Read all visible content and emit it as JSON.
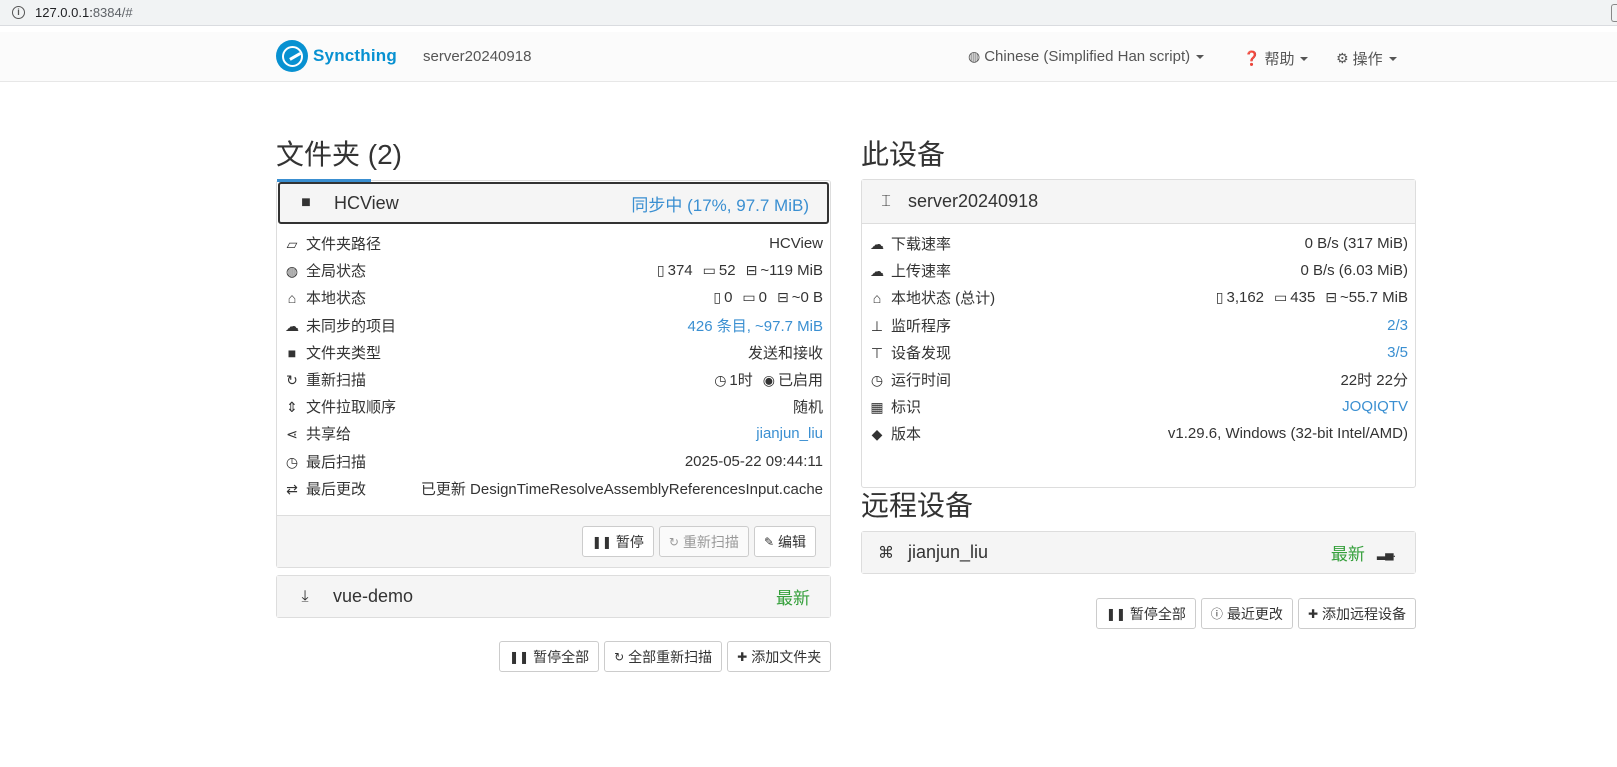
{
  "browser": {
    "url_host": "127.0.0.1:",
    "url_rest": "8384/#"
  },
  "navbar": {
    "brand": "Syncthing",
    "device_name": "server20240918",
    "language": "Chinese (Simplified Han script)",
    "help": "帮助",
    "actions": "操作"
  },
  "folders": {
    "title": "文件夹 (2)",
    "progress_percent": 17,
    "hcview": {
      "name": "HCView",
      "status": "同步中 (17%, 97.7 MiB)",
      "rows": {
        "path": {
          "label": "文件夹路径",
          "value": "HCView"
        },
        "global": {
          "label": "全局状态",
          "files": "374",
          "dirs": "52",
          "size": "~119 MiB"
        },
        "local": {
          "label": "本地状态",
          "files": "0",
          "dirs": "0",
          "size": "~0 B"
        },
        "out_of_sync": {
          "label": "未同步的项目",
          "value": "426 条目, ~97.7 MiB"
        },
        "type": {
          "label": "文件夹类型",
          "value": "发送和接收"
        },
        "rescan": {
          "label": "重新扫描",
          "interval": "1时",
          "watcher": "已启用"
        },
        "pull_order": {
          "label": "文件拉取顺序",
          "value": "随机"
        },
        "shared_with": {
          "label": "共享给",
          "value": "jianjun_liu"
        },
        "last_scan": {
          "label": "最后扫描",
          "value": "2025-05-22 09:44:11"
        },
        "last_change": {
          "label": "最后更改",
          "value": "已更新 DesignTimeResolveAssemblyReferencesInput.cache"
        }
      },
      "buttons": {
        "pause": "暂停",
        "rescan": "重新扫描",
        "edit": "编辑"
      }
    },
    "vue_demo": {
      "name": "vue-demo",
      "status": "最新"
    },
    "buttons": {
      "pause_all": "暂停全部",
      "rescan_all": "全部重新扫描",
      "add_folder": "添加文件夹"
    }
  },
  "this_device": {
    "title": "此设备",
    "name": "server20240918",
    "rows": {
      "download": {
        "label": "下载速率",
        "value": "0 B/s (317 MiB)"
      },
      "upload": {
        "label": "上传速率",
        "value": "0 B/s (6.03 MiB)"
      },
      "local_total": {
        "label": "本地状态 (总计)",
        "files": "3,162",
        "dirs": "435",
        "size": "~55.7 MiB"
      },
      "listeners": {
        "label": "监听程序",
        "value": "2/3"
      },
      "discovery": {
        "label": "设备发现",
        "value": "3/5"
      },
      "uptime": {
        "label": "运行时间",
        "value": "22时 22分"
      },
      "identity": {
        "label": "标识",
        "value": "JOQIQTV"
      },
      "version": {
        "label": "版本",
        "value": "v1.29.6, Windows (32-bit Intel/AMD)"
      }
    }
  },
  "remote_devices": {
    "title": "远程设备",
    "device": {
      "name": "jianjun_liu",
      "status": "最新"
    },
    "buttons": {
      "pause_all": "暂停全部",
      "recent_changes": "最近更改",
      "add_device": "添加远程设备"
    }
  }
}
